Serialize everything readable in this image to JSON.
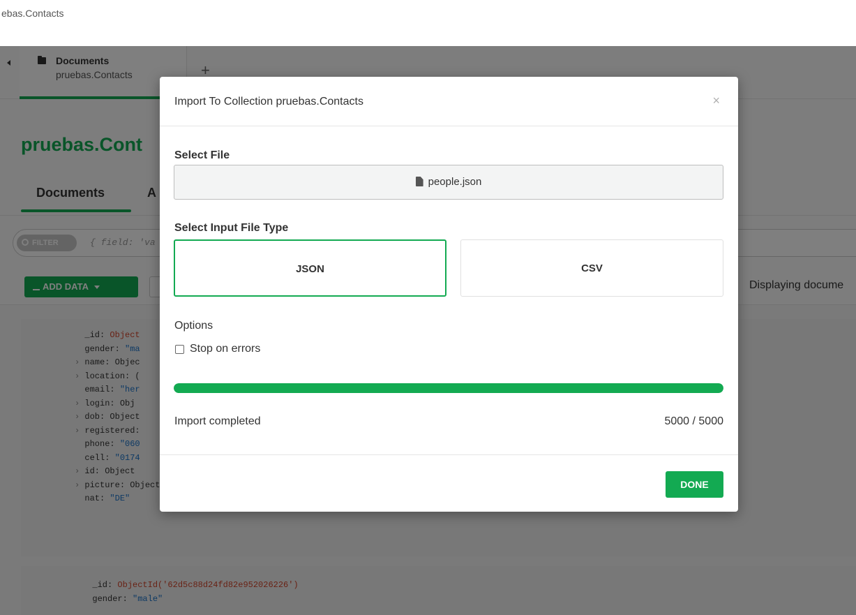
{
  "window": {
    "title": "ebas.Contacts"
  },
  "tabs": {
    "active": {
      "title": "Documents",
      "subtitle": "pruebas.Contacts"
    },
    "add_label": "+"
  },
  "collection": {
    "title": "pruebas.Cont",
    "subtabs": [
      "Documents",
      "A"
    ]
  },
  "filter": {
    "pill": "FILTER",
    "placeholder": "{ field: 'va"
  },
  "toolbar": {
    "add_data_label": "ADD DATA",
    "displaying": "Displaying docume"
  },
  "documents": [
    {
      "lines": [
        {
          "prefix": "",
          "key": "_id:",
          "value": "Object",
          "vclass": "oid"
        },
        {
          "prefix": "",
          "key": "gender:",
          "value": "\"ma",
          "vclass": "s"
        },
        {
          "prefix": "›",
          "key": "name:",
          "value": "Objec",
          "vclass": "k"
        },
        {
          "prefix": "›",
          "key": "location:",
          "value": "(",
          "vclass": "k"
        },
        {
          "prefix": "",
          "key": "email:",
          "value": "\"her",
          "vclass": "s"
        },
        {
          "prefix": "›",
          "key": "login:",
          "value": "Obj",
          "vclass": "k"
        },
        {
          "prefix": "›",
          "key": "dob:",
          "value": "Object",
          "vclass": "k"
        },
        {
          "prefix": "›",
          "key": "registered:",
          "value": "",
          "vclass": "k"
        },
        {
          "prefix": "",
          "key": "phone:",
          "value": "\"060",
          "vclass": "s"
        },
        {
          "prefix": "",
          "key": "cell:",
          "value": "\"0174",
          "vclass": "s"
        },
        {
          "prefix": "›",
          "key": "id:",
          "value": "Object",
          "vclass": "k"
        },
        {
          "prefix": "›",
          "key": "picture:",
          "value": "Object",
          "vclass": "k"
        },
        {
          "prefix": "",
          "key": "nat:",
          "value": "\"DE\"",
          "vclass": "s"
        }
      ]
    },
    {
      "lines": [
        {
          "prefix": "",
          "key": "_id:",
          "value": "ObjectId('62d5c88d24fd82e952026226')",
          "vclass": "oid"
        },
        {
          "prefix": "",
          "key": "gender:",
          "value": "\"male\"",
          "vclass": "s"
        }
      ]
    }
  ],
  "modal": {
    "title": "Import To Collection pruebas.Contacts",
    "close": "×",
    "select_file_label": "Select File",
    "file_name": "people.json",
    "input_type_label": "Select Input File Type",
    "types": [
      "JSON",
      "CSV"
    ],
    "selected_type": "JSON",
    "options_label": "Options",
    "stop_on_errors_label": "Stop on errors",
    "stop_on_errors_checked": false,
    "progress_percent": 100,
    "status": "Import completed",
    "count": "5000 / 5000",
    "done_label": "DONE"
  },
  "colors": {
    "accent": "#13aa52",
    "string": "#1a73c8",
    "objectid": "#d2452a"
  }
}
